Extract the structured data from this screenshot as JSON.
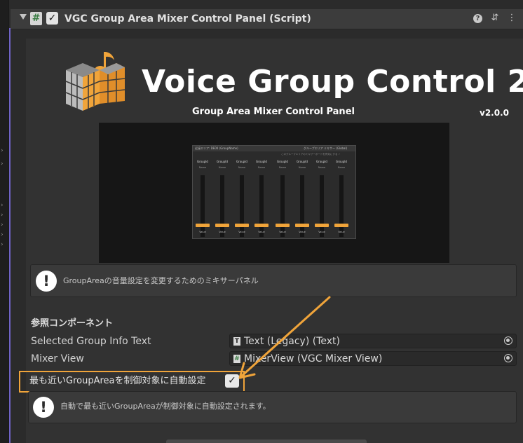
{
  "header": {
    "title": "VGC Group Area Mixer Control Panel (Script)",
    "enabled": true
  },
  "logo": {
    "title": "Voice Group Control 2",
    "subtitle": "Group Area Mixer Control Panel",
    "version": "v2.0.0"
  },
  "preview": {
    "top_left": "近接エリア: DE00 (GroupName)",
    "top_right": "グループエリア ミキサー (Global)",
    "note": "このグループエリアのミキサーボードを有効にする ✓",
    "channels": [
      {
        "label": "GroupId",
        "name": "Name",
        "value": "Value"
      },
      {
        "label": "GroupId",
        "name": "Name",
        "value": "Value"
      },
      {
        "label": "GroupId",
        "name": "Name",
        "value": "Value"
      },
      {
        "label": "GroupId",
        "name": "Name",
        "value": "Value"
      },
      {
        "label": "GroupId",
        "name": "Name",
        "value": "Value"
      },
      {
        "label": "GroupId",
        "name": "Name",
        "value": "Value"
      },
      {
        "label": "GroupId",
        "name": "Name",
        "value": "Value"
      },
      {
        "label": "GroupId",
        "name": "Name",
        "value": "Value"
      }
    ]
  },
  "info_box": {
    "text": "GroupAreaの音量設定を変更するためのミキサーパネル"
  },
  "references": {
    "section_title": "参照コンポーネント",
    "fields": [
      {
        "label": "Selected Group Info Text",
        "value": "Text (Legacy) (Text)",
        "icon": "text-component-icon"
      },
      {
        "label": "Mixer View",
        "value": "MixerView (VGC Mixer View)",
        "icon": "script-component-icon"
      }
    ]
  },
  "auto_setting": {
    "label": "最も近いGroupAreaを制御対象に自動設定",
    "checked": true,
    "help": "自動で最も近いGroupAreaが制御対象に自動設定されます。"
  },
  "colors": {
    "accent": "#f0a43a",
    "side_accent": "#6f63c6",
    "panel_bg": "#323232"
  }
}
